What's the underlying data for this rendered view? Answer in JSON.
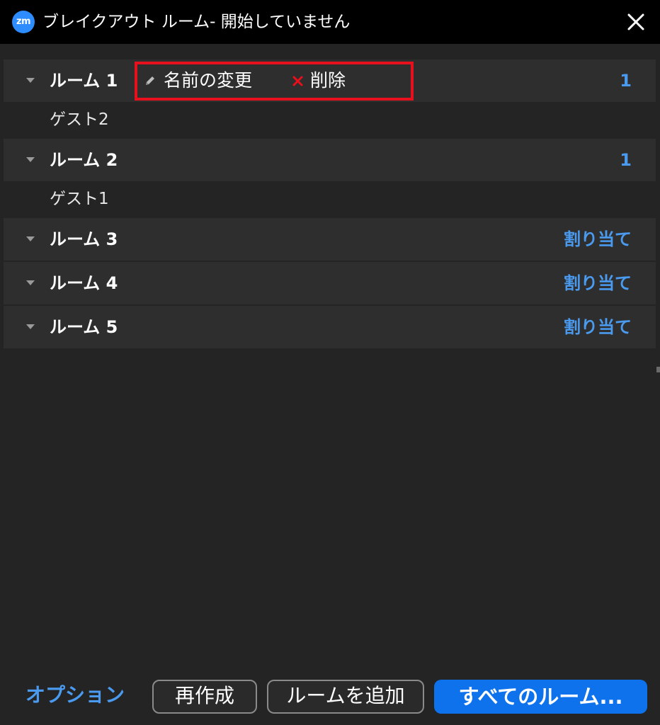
{
  "window": {
    "app_icon_text": "zm",
    "title": "ブレイクアウト ルーム- 開始していません"
  },
  "rooms": [
    {
      "name": "ルーム 1",
      "count": "1",
      "actions": {
        "rename": "名前の変更",
        "delete": "削除"
      },
      "participants": [
        "ゲスト2"
      ]
    },
    {
      "name": "ルーム 2",
      "count": "1",
      "participants": [
        "ゲスト1"
      ]
    },
    {
      "name": "ルーム 3",
      "assign": "割り当て"
    },
    {
      "name": "ルーム 4",
      "assign": "割り当て"
    },
    {
      "name": "ルーム 5",
      "assign": "割り当て"
    }
  ],
  "footer": {
    "options": "オプション",
    "recreate": "再作成",
    "add_room": "ルームを追加",
    "open_all": "すべてのルーム..."
  },
  "colors": {
    "accent": "#4a9bf0",
    "primary_button": "#0e72ed",
    "highlight_box": "#e8101c",
    "delete_icon": "#e8101c"
  }
}
